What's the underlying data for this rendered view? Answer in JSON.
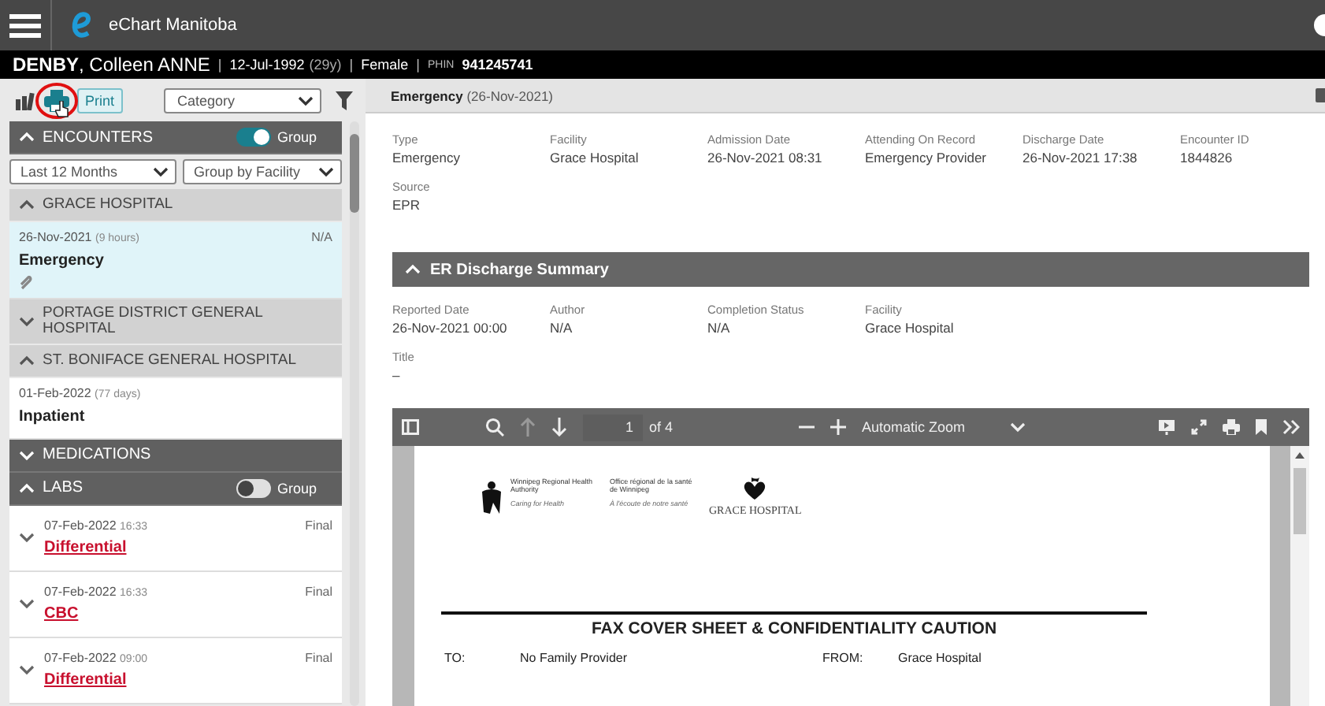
{
  "app_bar": {
    "title": "eChart Manitoba"
  },
  "patient": {
    "name": "**DENBY**, Colleen ANNE",
    "dob": "12-Jul-1992",
    "age": "(29y)",
    "sex": "Female",
    "phin_label": "PHIN",
    "phin": "941245741",
    "separators": [
      "|",
      "|",
      "|"
    ]
  },
  "left_toolbar": {
    "print_label": "Print",
    "category": "Category"
  },
  "encounters": {
    "title": "ENCOUNTERS",
    "expanded": true,
    "group_label": "Group",
    "group_on": true,
    "period": "Last 12 Months",
    "grouping": "Group by Facility",
    "groups": [
      {
        "name": "GRACE HOSPITAL",
        "expanded": true,
        "items": [
          {
            "date": "26-Nov-2021",
            "duration": "(9 hours)",
            "status": "N/A",
            "type": "Emergency",
            "attachment": true,
            "selected": true
          }
        ]
      },
      {
        "name": "PORTAGE DISTRICT GENERAL HOSPITAL",
        "expanded": false
      },
      {
        "name": "ST. BONIFACE GENERAL HOSPITAL",
        "expanded": true,
        "items": [
          {
            "date": "01-Feb-2022",
            "duration": "(77 days)",
            "type": "Inpatient",
            "attachment": false,
            "selected": false
          }
        ]
      }
    ]
  },
  "medications": {
    "title": "MEDICATIONS",
    "expanded": false
  },
  "labs": {
    "title": "LABS",
    "expanded": true,
    "group_label": "Group",
    "group_on": false,
    "items": [
      {
        "date": "07-Feb-2022",
        "time": "16:33",
        "status": "Final",
        "name": "Differential",
        "expanded": false
      },
      {
        "date": "07-Feb-2022",
        "time": "16:33",
        "status": "Final",
        "name": "CBC",
        "expanded": false
      },
      {
        "date": "07-Feb-2022",
        "time": "09:00",
        "status": "Final",
        "name": "Differential",
        "expanded": false
      }
    ]
  },
  "detail": {
    "title": "Emergency",
    "date": "(26-Nov-2021)",
    "fields": [
      {
        "label": "Type",
        "value": "Emergency"
      },
      {
        "label": "Facility",
        "value": "Grace Hospital"
      },
      {
        "label": "Admission Date",
        "value": "26-Nov-2021 08:31"
      },
      {
        "label": "Attending On Record",
        "value": "Emergency Provider"
      },
      {
        "label": "Discharge Date",
        "value": "26-Nov-2021 17:38"
      },
      {
        "label": "Encounter ID",
        "value": "1844826"
      },
      {
        "label": "Source",
        "value": "EPR"
      }
    ],
    "section": {
      "title": "ER Discharge Summary",
      "expanded": true,
      "fields": [
        {
          "label": "Reported Date",
          "value": "26-Nov-2021 00:00"
        },
        {
          "label": "Author",
          "value": "N/A"
        },
        {
          "label": "Completion Status",
          "value": "N/A"
        },
        {
          "label": "Facility",
          "value": "Grace Hospital"
        },
        {
          "label": "Title",
          "value": "–"
        }
      ]
    }
  },
  "pdf_viewer": {
    "page": "1",
    "page_count": "of 4",
    "zoom": "Automatic Zoom",
    "document": {
      "org_en": "Winnipeg Regional Health Authority",
      "org_fr": "Office régional de la santé de Winnipeg",
      "tagline_en": "Caring for Health",
      "tagline_fr": "À l'écoute de notre santé",
      "hospital": "GRACE HOSPITAL",
      "heading": "FAX COVER SHEET & CONFIDENTIALITY CAUTION",
      "rows": [
        {
          "label": "TO:",
          "value": "No Family Provider"
        },
        {
          "label": "FROM:",
          "value": "Grace Hospital"
        }
      ]
    }
  }
}
